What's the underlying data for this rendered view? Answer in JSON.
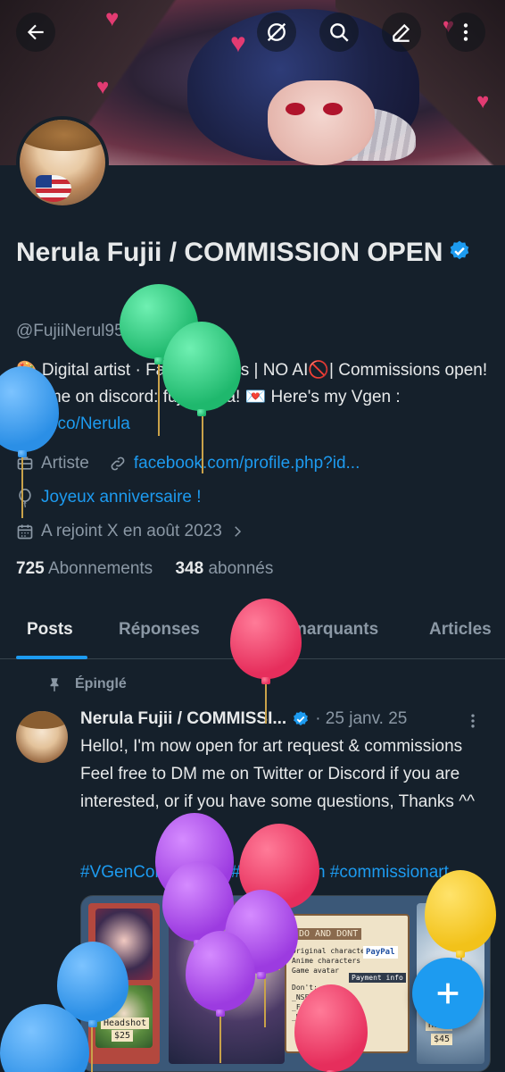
{
  "profile": {
    "name": "Nerula Fujii / COMMISSION OPEN",
    "handle": "@FujiiNerul9566",
    "bio_prefix": "🎨 Digital artist · Fanart & OCs | NO AI🚫| Commissions open! DM me on discord: fujiinerula! 💌 Here's my Vgen : ",
    "bio_link": "vgen.co/Nerula",
    "category": "Artiste",
    "website": "facebook.com/profile.php?id...",
    "birthday": "Joyeux anniversaire !",
    "joined": "A rejoint X en août 2023",
    "following_count": "725",
    "following_label": "Abonnements",
    "followers_count": "348",
    "followers_label": "abonnés"
  },
  "tabs": [
    {
      "label": "Posts"
    },
    {
      "label": "Réponses"
    },
    {
      "label": "Posts marquants"
    },
    {
      "label": "Articles"
    }
  ],
  "tweet": {
    "pinned_label": "Épinglé",
    "author": "Nerula Fujii / COMMISSI...",
    "date": "· 25 janv. 25",
    "text": "Hello!, I'm now open for art request & commissions  Feel free to DM me on Twitter or Discord if you are interested, or if you have some questions, Thanks ^^",
    "hashtags": "#VGenCommission #VGenOpen #commissionart",
    "media": {
      "dos_donts": "DO AND DONT",
      "do_items": "Original characters\nAnime characters\nGame avatar",
      "dont_label": "Don't:",
      "dont_items": "_NSFW\n_Full armor\n_Mecha",
      "payment": "Payment info",
      "headshot": "Headshot",
      "headshot_price": "$25",
      "half_label": "Half",
      "half_price": "$45",
      "paypal": "PayPal"
    }
  },
  "colors": {
    "background": "#15202b",
    "accent": "#1d9bf0",
    "muted": "#8b98a5",
    "text": "#e7e9ea"
  },
  "icons": [
    "back-arrow-icon",
    "grok-icon",
    "search-icon",
    "edit-icon",
    "more-vertical-icon",
    "verified-badge-icon",
    "category-icon",
    "link-icon",
    "balloon-icon",
    "calendar-icon",
    "chevron-right-icon",
    "pin-icon",
    "plus-icon"
  ]
}
